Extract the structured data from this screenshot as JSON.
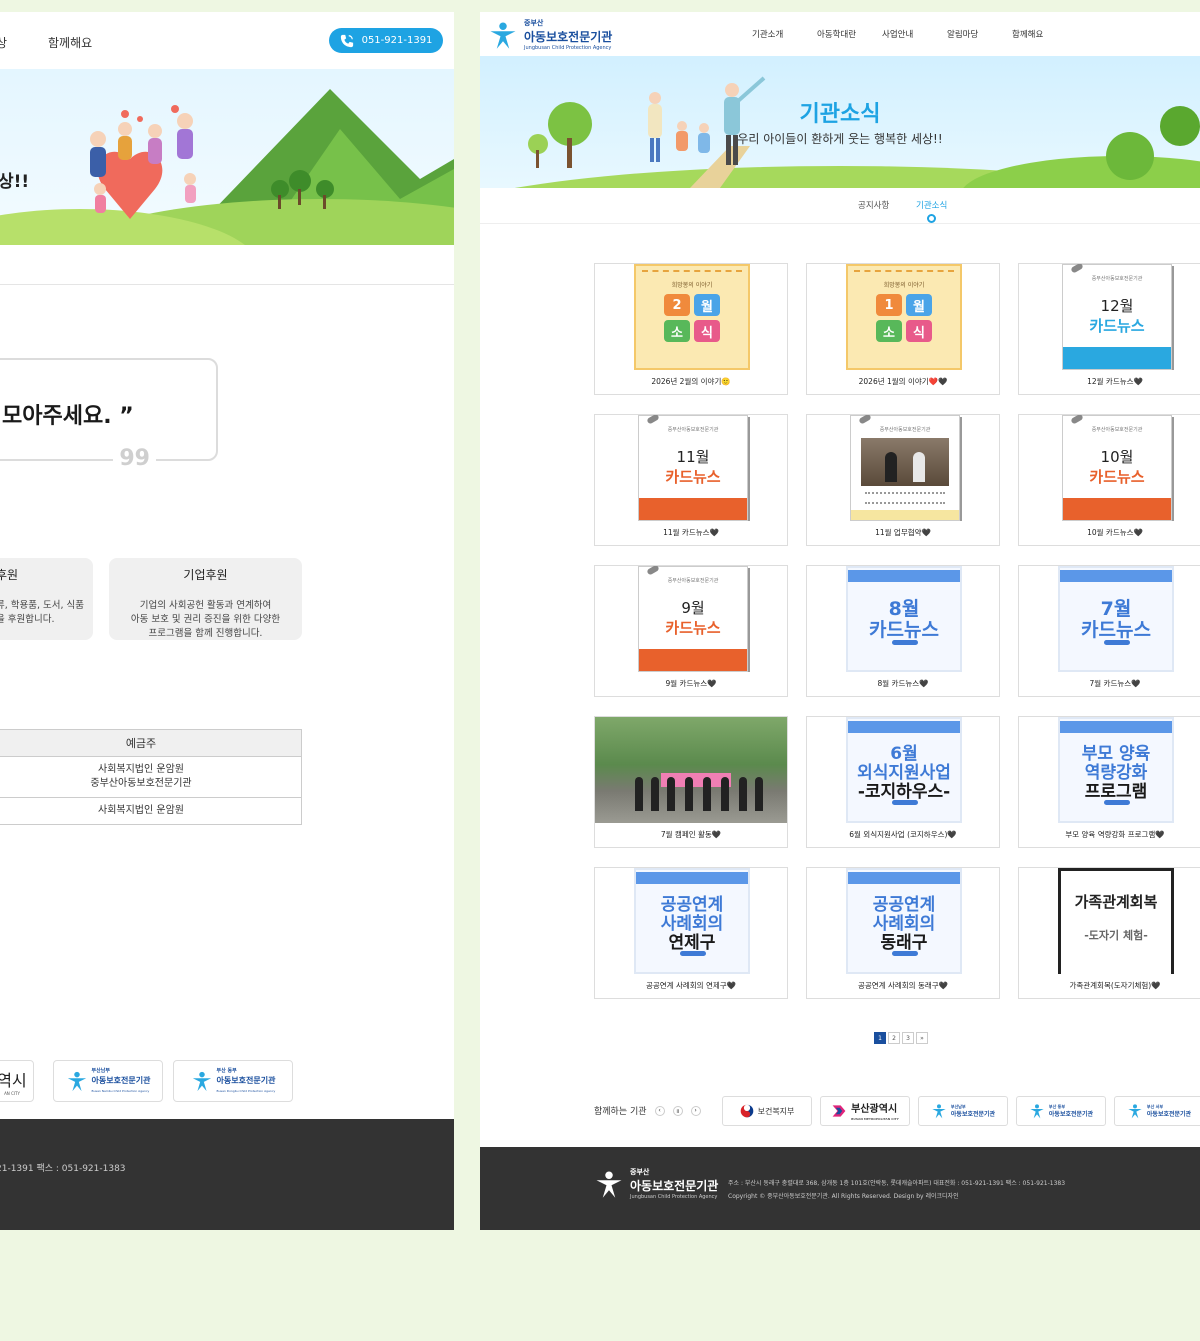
{
  "left_panel": {
    "nav": {
      "item_partial": "상",
      "item_together": "함께해요"
    },
    "phone": {
      "label": "051-921-1391",
      "icon": "phone-icon"
    },
    "hero_slogan_partial": "상!!",
    "quote_text": "모아주세요. ”",
    "quote_mark": "99",
    "cards": [
      {
        "title": "후원",
        "desc": "류, 학용품, 도서, 식품\n을 후원합니다."
      },
      {
        "title": "기업후원",
        "desc": "기업의 사회공헌 활동과 연계하여\n아동 보호 및 권리 증진을 위한 다양한\n프로그램을 함께 진행합니다."
      }
    ],
    "account_table": {
      "header": "예금주",
      "rows": [
        "사회복지법인 운암원\n중부산아동보호전문기관",
        "사회복지법인 운암원"
      ]
    },
    "partners": [
      {
        "label": "역시"
      },
      {
        "top": "부산남부",
        "main": "아동보호전문기관",
        "sub": "Busan Nambu Child Protection Agency"
      },
      {
        "top": "부산 동부",
        "main": "아동보호전문기관",
        "sub": "Busan Dongbu Child Protection Agency"
      }
    ],
    "partner_partial_sub": "AN CITY",
    "footer_text": "21-1391   팩스 : 051-921-1383"
  },
  "right_panel": {
    "logo": {
      "top": "중부산",
      "main": "아동보호전문기관",
      "sub": "Jungbusan Child Protection Agency",
      "icon": "child-protection-logo-icon"
    },
    "menu": [
      "기관소개",
      "아동학대란",
      "사업안내",
      "알림마당",
      "함께해요"
    ],
    "banner": {
      "title": "기관소식",
      "subtitle": "우리 아이들이 환하게 웃는 행복한 세상!!"
    },
    "subtabs": [
      {
        "label": "공지사항",
        "active": false
      },
      {
        "label": "기관소식",
        "active": true
      }
    ],
    "posts": [
      {
        "caption": "2026년 2월의 이야기🙂",
        "thumb": {
          "type": "month",
          "tiles": [
            "2",
            "월",
            "소",
            "식"
          ],
          "header": "희망봉의 이야기"
        }
      },
      {
        "caption": "2026년 1월의 이야기❤️🖤",
        "thumb": {
          "type": "month",
          "tiles": [
            "1",
            "월",
            "소",
            "식"
          ],
          "header": "희망봉의 이야기"
        }
      },
      {
        "caption": "12월 카드뉴스🖤",
        "thumb": {
          "type": "card",
          "month": "12월",
          "label": "카드뉴스",
          "band": "#2aa8e0",
          "header": "중부산아동보호전문기관"
        }
      },
      {
        "caption": "11월 카드뉴스🖤",
        "thumb": {
          "type": "card",
          "month": "11월",
          "label": "카드뉴스",
          "band": "#e8612c",
          "header": "중부산아동보호전문기관"
        }
      },
      {
        "caption": "11월 업무협약🖤",
        "thumb": {
          "type": "photo-card",
          "header": "중부산아동보호전문기관"
        }
      },
      {
        "caption": "10월 카드뉴스🖤",
        "thumb": {
          "type": "card",
          "month": "10월",
          "label": "카드뉴스",
          "band": "#e8612c",
          "header": "중부산아동보호전문기관"
        }
      },
      {
        "caption": "9월 카드뉴스🖤",
        "thumb": {
          "type": "card",
          "month": "9월",
          "label": "카드뉴스",
          "band": "#e8612c",
          "header": "중부산아동보호전문기관"
        }
      },
      {
        "caption": "8월 카드뉴스🖤",
        "thumb": {
          "type": "blue",
          "lines": [
            "8월",
            "카드뉴스"
          ]
        }
      },
      {
        "caption": "7월 카드뉴스🖤",
        "thumb": {
          "type": "blue",
          "lines": [
            "7월",
            "카드뉴스"
          ]
        }
      },
      {
        "caption": "7월 캠페인 활동🖤",
        "thumb": {
          "type": "photo"
        }
      },
      {
        "caption": "6월 외식지원사업 (코지하우스)🖤",
        "thumb": {
          "type": "blue",
          "lines": [
            "6월",
            "외식지원사업",
            "-코지하우스-"
          ]
        }
      },
      {
        "caption": "부모 양육 역량강화 프로그램🖤",
        "thumb": {
          "type": "blue",
          "lines": [
            "부모 양육",
            "역량강화",
            "프로그램"
          ]
        }
      },
      {
        "caption": "공공연계 사례회의 연제구🖤",
        "thumb": {
          "type": "blue",
          "lines": [
            "공공연계",
            "사례회의",
            "연제구"
          ]
        }
      },
      {
        "caption": "공공연계 사례회의 동래구🖤",
        "thumb": {
          "type": "blue",
          "lines": [
            "공공연계",
            "사례회의",
            "동래구"
          ]
        }
      },
      {
        "caption": "가족관계회복(도자기체험)🖤",
        "thumb": {
          "type": "family",
          "lines": [
            "가족관계회복",
            "-도자기 체험-"
          ]
        }
      }
    ],
    "pagination": {
      "pages": [
        "1",
        "2",
        "3"
      ],
      "current": "1",
      "next": "»"
    },
    "partners_label": "함께하는 기관",
    "partners_controls": [
      "‹",
      "॥",
      "›"
    ],
    "partners": [
      {
        "name": "보건복지부",
        "icon": "taegeuk-icon"
      },
      {
        "name": "부산광역시",
        "sub": "BUSAN METROPOLITAN CITY",
        "icon": "busan-logo-icon"
      },
      {
        "top": "부산남부",
        "name": "아동보호전문기관",
        "icon": "child-protection-logo-icon"
      },
      {
        "top": "부산 동부",
        "name": "아동보호전문기관",
        "icon": "child-protection-logo-icon"
      },
      {
        "top": "부산 서부",
        "name": "아동보호전문기관",
        "icon": "child-protection-logo-icon"
      }
    ],
    "footer": {
      "logo_top": "중부산",
      "logo_main": "아동보호전문기관",
      "logo_sub": "Jungbusan Child Protection Agency",
      "address": "주소 : 부산시 동래구 충렬대로 368, 삼개동 1층 101호(안락동, 롯데캐슬아파트)   대표전화 : 051-921-1391   팩스 : 051-921-1383",
      "copyright": "Copyright © 중부산아동보호전문기관. All Rights Reserved. Design by 레이크디자인"
    }
  },
  "colors": {
    "accent": "#1ea3e3",
    "brand": "#1a4f9e",
    "footer_bg": "#333333",
    "page_bg": "#eef7e2"
  }
}
